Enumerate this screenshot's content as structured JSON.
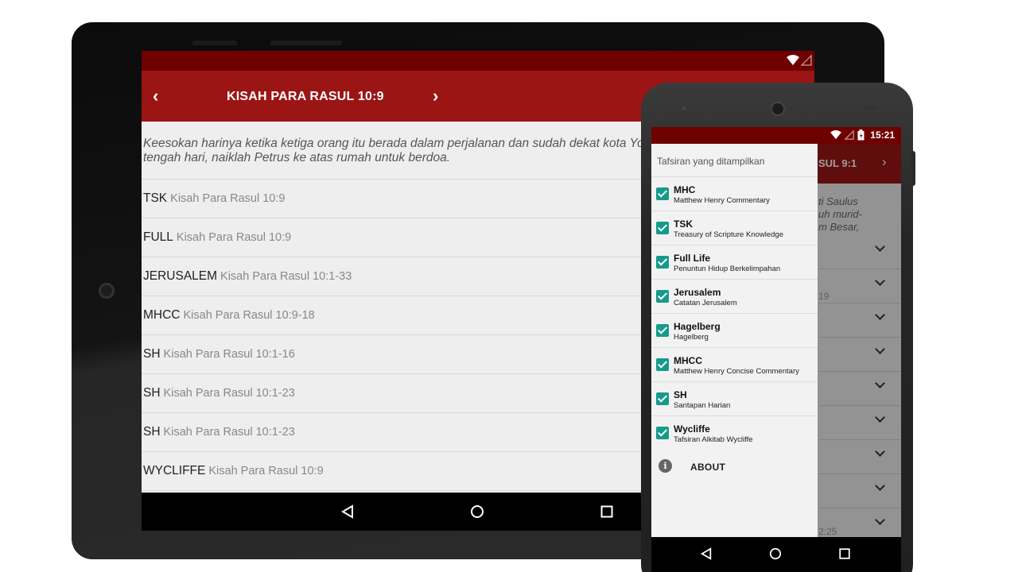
{
  "tablet": {
    "toolbar": {
      "title": "KISAH PARA RASUL 10:9",
      "prev": "‹",
      "next": "›"
    },
    "verse": {
      "line1": "Keesokan harinya ketika ketiga orang itu berada dalam perjalanan dan sudah dekat kota Yo",
      "line2": "tengah hari, naiklah Petrus ke atas rumah untuk berdoa."
    },
    "rows": [
      {
        "source": "TSK",
        "ref": "Kisah Para Rasul 10:9"
      },
      {
        "source": "FULL",
        "ref": "Kisah Para Rasul 10:9"
      },
      {
        "source": "JERUSALEM",
        "ref": "Kisah Para Rasul 10:1-33"
      },
      {
        "source": "MHCC",
        "ref": "Kisah Para Rasul 10:9-18"
      },
      {
        "source": "SH",
        "ref": "Kisah Para Rasul 10:1-16"
      },
      {
        "source": "SH",
        "ref": "Kisah Para Rasul 10:1-23"
      },
      {
        "source": "SH",
        "ref": "Kisah Para Rasul 10:1-23"
      },
      {
        "source": "WYCLIFFE",
        "ref": "Kisah Para Rasul 10:9"
      }
    ]
  },
  "phone": {
    "status": {
      "time": "15:21"
    },
    "toolbar": {
      "title_partial": "SUL 9:1",
      "next": "›"
    },
    "verse_partial": [
      "ti Saulus",
      "uh murid-",
      "m Besar,"
    ],
    "partial_refs": [
      "19",
      "2:25"
    ],
    "drawer": {
      "header": "Tafsiran yang ditampilkan",
      "items": [
        {
          "name": "MHC",
          "sub": "Matthew Henry Commentary",
          "checked": true
        },
        {
          "name": "TSK",
          "sub": "Treasury of Scripture Knowledge",
          "checked": true
        },
        {
          "name": "Full Life",
          "sub": "Penuntun Hidup Berkelimpahan",
          "checked": true
        },
        {
          "name": "Jerusalem",
          "sub": "Catatan Jerusalem",
          "checked": true
        },
        {
          "name": "Hagelberg",
          "sub": "Hagelberg",
          "checked": true
        },
        {
          "name": "MHCC",
          "sub": "Matthew Henry Concise Commentary",
          "checked": true
        },
        {
          "name": "SH",
          "sub": "Santapan Harian",
          "checked": true
        },
        {
          "name": "Wycliffe",
          "sub": "Tafsiran Alkitab Wycliffe",
          "checked": true
        }
      ],
      "about_label": "ABOUT",
      "about_icon": "i"
    }
  },
  "colors": {
    "status_bar": "#6e0000",
    "toolbar": "#9b1515",
    "checkbox": "#159a8c"
  },
  "icons": [
    "chevron-left-icon",
    "chevron-right-icon",
    "chevron-down-icon",
    "wifi-icon",
    "signal-icon",
    "battery-icon",
    "back-nav-icon",
    "home-nav-icon",
    "recents-nav-icon",
    "info-icon",
    "check-icon"
  ]
}
